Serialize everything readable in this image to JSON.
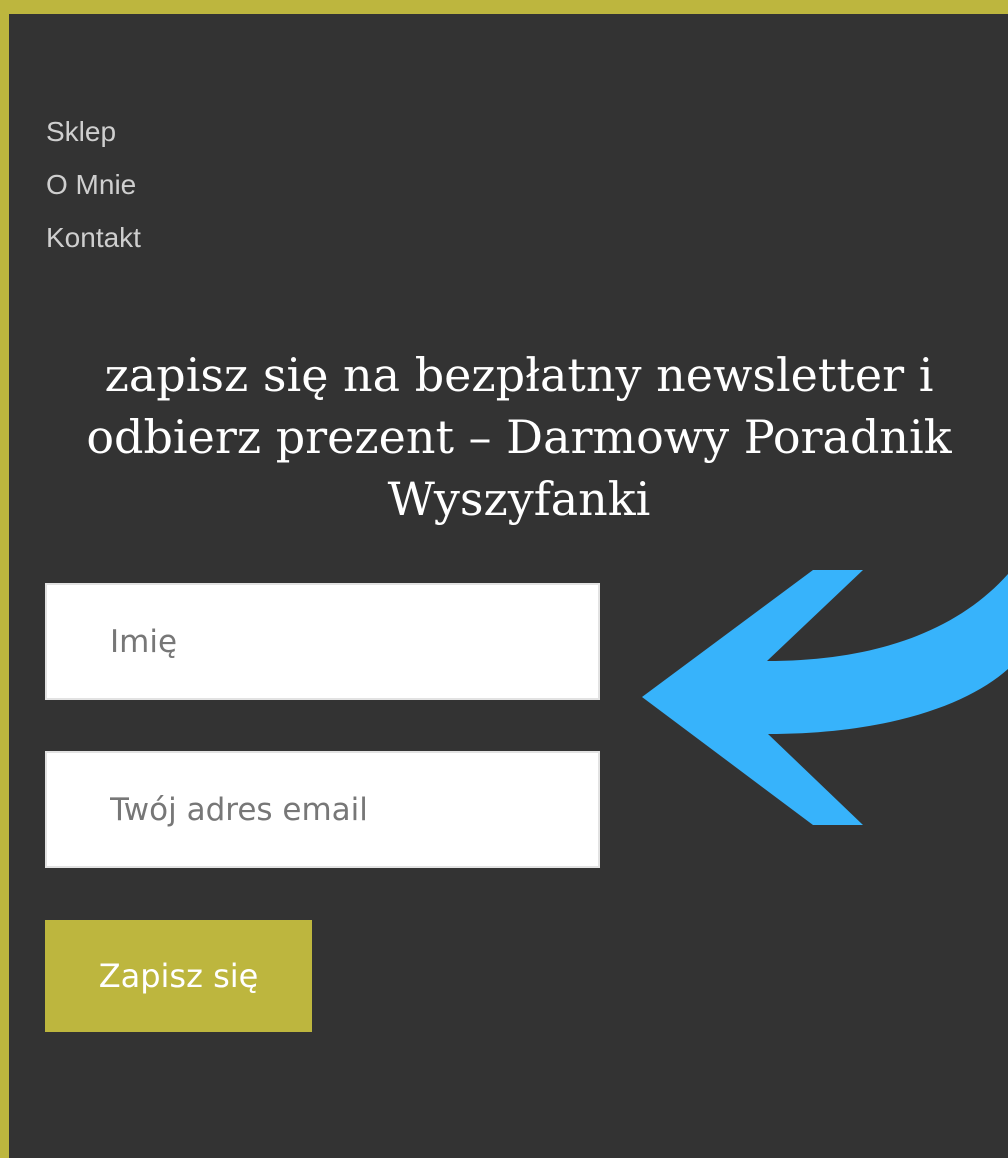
{
  "nav": {
    "items": [
      {
        "label": "Sklep"
      },
      {
        "label": "O Mnie"
      },
      {
        "label": "Kontakt"
      }
    ]
  },
  "newsletter": {
    "heading": "zapisz się na bezpłatny newsletter i odbierz prezent – Darmowy Poradnik Wyszyfanki",
    "name_placeholder": "Imię",
    "name_value": "",
    "email_placeholder": "Twój adres email",
    "email_value": "",
    "submit_label": "Zapisz się"
  },
  "icons": {
    "arrow": "arrow-left-curved-icon"
  },
  "colors": {
    "accent": "#bdb63e",
    "background": "#333333",
    "arrow": "#37b3fb",
    "field": "#ffffff"
  }
}
